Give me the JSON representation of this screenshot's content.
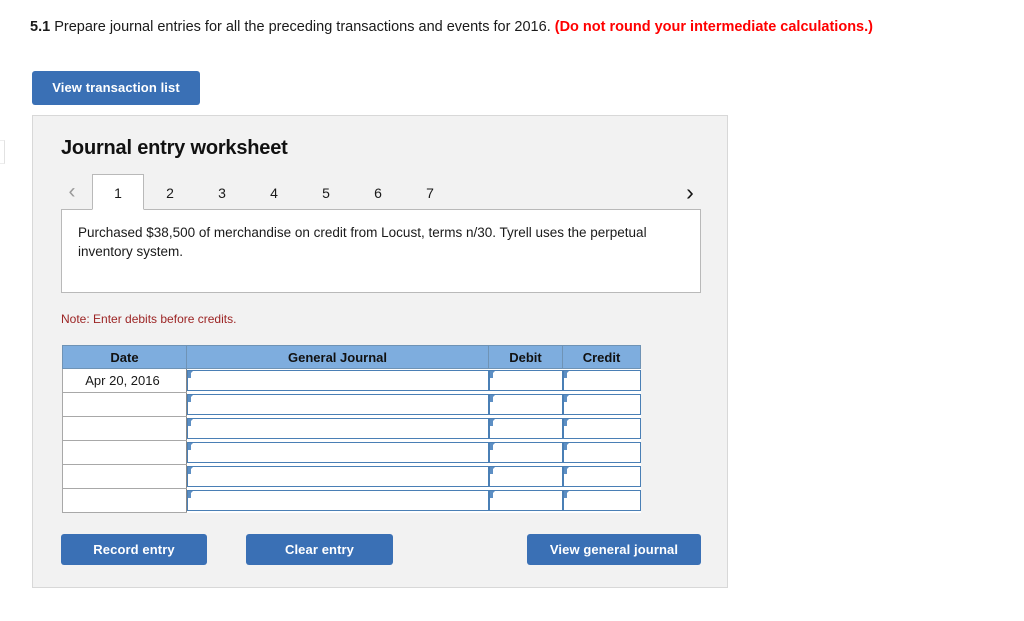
{
  "question": {
    "number": "5.1",
    "text": " Prepare journal entries for all the preceding transactions and events for 2016. ",
    "warning": "(Do not round your intermediate calculations.)"
  },
  "toolbar": {
    "view_transaction_list_label": "View transaction list"
  },
  "worksheet": {
    "title": "Journal entry worksheet",
    "tabs": [
      {
        "label": "1",
        "active": true
      },
      {
        "label": "2",
        "active": false
      },
      {
        "label": "3",
        "active": false
      },
      {
        "label": "4",
        "active": false
      },
      {
        "label": "5",
        "active": false
      },
      {
        "label": "6",
        "active": false
      },
      {
        "label": "7",
        "active": false
      }
    ],
    "prev_arrow": "‹",
    "next_arrow": "›",
    "transaction_description": "Purchased $38,500 of merchandise on credit from Locust, terms n/30. Tyrell uses the perpetual inventory system.",
    "note": "Note: Enter debits before credits."
  },
  "table": {
    "headers": [
      "Date",
      "General Journal",
      "Debit",
      "Credit"
    ],
    "rows": [
      {
        "date": "Apr 20, 2016",
        "general_journal": "",
        "debit": "",
        "credit": ""
      },
      {
        "date": "",
        "general_journal": "",
        "debit": "",
        "credit": ""
      },
      {
        "date": "",
        "general_journal": "",
        "debit": "",
        "credit": ""
      },
      {
        "date": "",
        "general_journal": "",
        "debit": "",
        "credit": ""
      },
      {
        "date": "",
        "general_journal": "",
        "debit": "",
        "credit": ""
      },
      {
        "date": "",
        "general_journal": "",
        "debit": "",
        "credit": ""
      }
    ]
  },
  "actions": {
    "record_entry_label": "Record entry",
    "clear_entry_label": "Clear entry",
    "view_general_journal_label": "View general journal"
  },
  "colors": {
    "button_blue": "#3a70b5",
    "table_header_blue": "#7eadde",
    "input_border_blue": "#4a7fb5",
    "warning_red": "#ff0000",
    "note_red": "#9c2424",
    "panel_gray": "#f2f2f2"
  }
}
